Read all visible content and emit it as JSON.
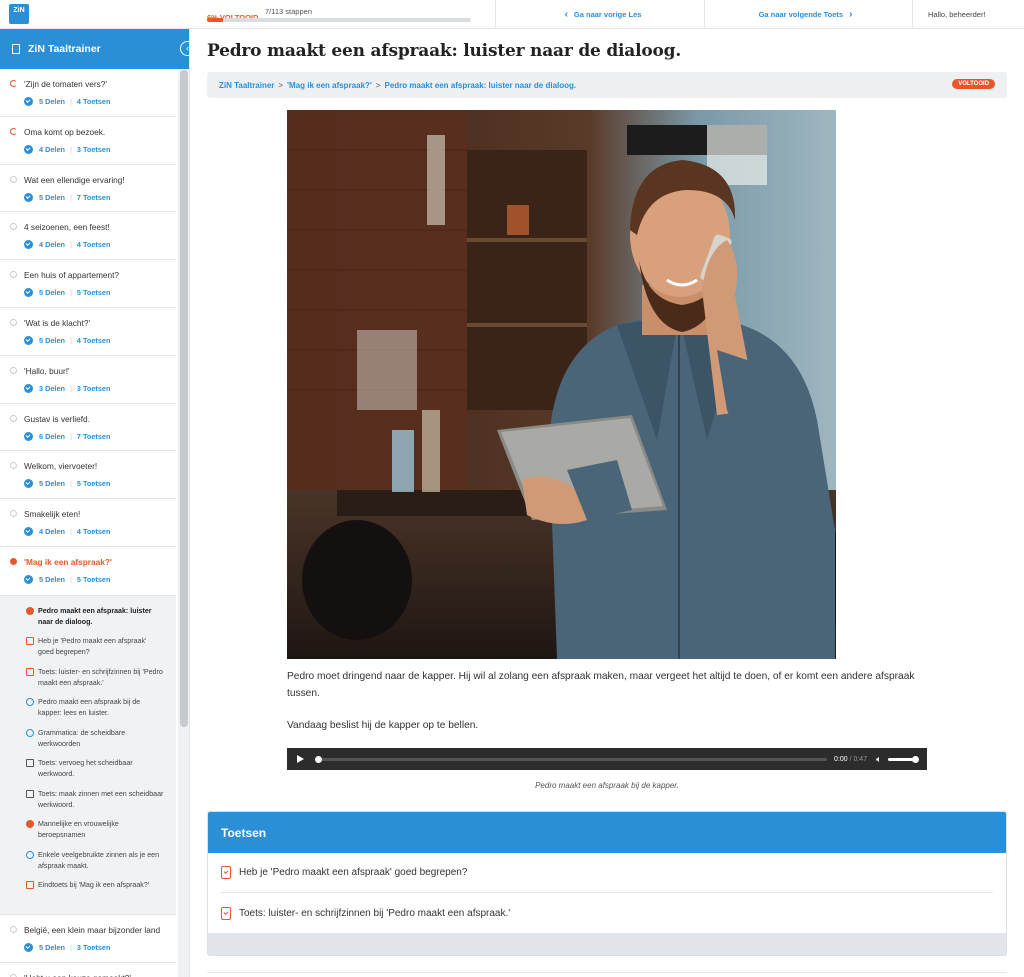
{
  "topbar": {
    "logo_text": "ZiN",
    "progress_label": "6% VOLTOOID",
    "progress_fraction": 0.06,
    "steps_label": "7/113 stappen",
    "prev_label": "Ga naar vorige Les",
    "next_label": "Ga naar volgende Toets",
    "greeting": "Hallo, beheerder!"
  },
  "sidebar": {
    "title": "ZiN Taaltrainer",
    "lessons": [
      {
        "title": "'Zijn de tomaten vers?'",
        "parts": "5 Delen",
        "tests": "4 Toetsen",
        "status": "partial"
      },
      {
        "title": "Oma komt op bezoek.",
        "parts": "4 Delen",
        "tests": "3 Toetsen",
        "status": "partial"
      },
      {
        "title": "Wat een ellendige ervaring!",
        "parts": "5 Delen",
        "tests": "7 Toetsen",
        "status": "none"
      },
      {
        "title": "4 seizoenen, een feest!",
        "parts": "4 Delen",
        "tests": "4 Toetsen",
        "status": "none"
      },
      {
        "title": "Een huis of appartement?",
        "parts": "5 Delen",
        "tests": "5 Toetsen",
        "status": "none"
      },
      {
        "title": "'Wat is de klacht?'",
        "parts": "5 Delen",
        "tests": "4 Toetsen",
        "status": "none"
      },
      {
        "title": "'Hallo, buur!'",
        "parts": "3 Delen",
        "tests": "3 Toetsen",
        "status": "none"
      },
      {
        "title": "Gustav is verliefd.",
        "parts": "6 Delen",
        "tests": "7 Toetsen",
        "status": "none"
      },
      {
        "title": "Welkom, viervoeter!",
        "parts": "5 Delen",
        "tests": "5 Toetsen",
        "status": "none"
      },
      {
        "title": "Smakelijk eten!",
        "parts": "4 Delen",
        "tests": "4 Toetsen",
        "status": "none"
      }
    ],
    "active_lesson": {
      "title": "'Mag ik een afspraak?'",
      "parts": "5 Delen",
      "tests": "5 Toetsen",
      "steps": [
        {
          "label": "Pedro maakt een afspraak: luister naar de dialoog.",
          "kind": "done",
          "current": true
        },
        {
          "label": "Heb je 'Pedro maakt een afspraak' goed begrepen?",
          "kind": "test"
        },
        {
          "label": "Toets: luister- en schrijfzinnen bij 'Pedro maakt een afspraak.'",
          "kind": "test"
        },
        {
          "label": "Pedro maakt een afspraak bij de kapper: lees en luister.",
          "kind": "circle"
        },
        {
          "label": "Grammatica: de scheidbare werkwoorden",
          "kind": "circle"
        },
        {
          "label": "Toets: vervoeg het scheidbaar werkwoord.",
          "kind": "test-dark"
        },
        {
          "label": "Toets: maak zinnen met een scheidbaar werkwoord.",
          "kind": "test-dark"
        },
        {
          "label": "Mannelijke en vrouwelijke beroepsnamen",
          "kind": "done"
        },
        {
          "label": "Enkele veelgebruikte zinnen als je een afspraak maakt.",
          "kind": "circle"
        },
        {
          "label": "Eindtoets bij 'Mag ik een afspraak?'",
          "kind": "test"
        }
      ]
    },
    "after_lessons": [
      {
        "title": "België, een klein maar bijzonder land",
        "parts": "5 Delen",
        "tests": "3 Toetsen"
      },
      {
        "title": "'Hebt u een keuze gemaakt?'",
        "parts": "",
        "tests": ""
      }
    ]
  },
  "main": {
    "title": "Pedro maakt een afspraak: luister naar de dialoog.",
    "breadcrumb": [
      "ZiN Taaltrainer",
      "'Mag ik een afspraak?'",
      "Pedro maakt een afspraak: luister naar de dialoog."
    ],
    "badge": "VOLTOOID",
    "paragraph1": "Pedro moet dringend naar de kapper. Hij wil al zolang een afspraak maken, maar vergeet het altijd te doen, of er komt een andere afspraak tussen.",
    "paragraph2": "Vandaag beslist hij de kapper op te bellen.",
    "audio": {
      "current": "0:00",
      "duration": "/ 0:47"
    },
    "caption": "Pedro maakt een afspraak bij de kapper.",
    "tests_title": "Toetsen",
    "tests": [
      "Heb je 'Pedro maakt een afspraak' goed begrepen?",
      "Toets: luister- en schrijfzinnen bij 'Pedro maakt een afspraak.'"
    ]
  },
  "colors": {
    "accent": "#2b8fd6",
    "done": "#e8572a"
  }
}
